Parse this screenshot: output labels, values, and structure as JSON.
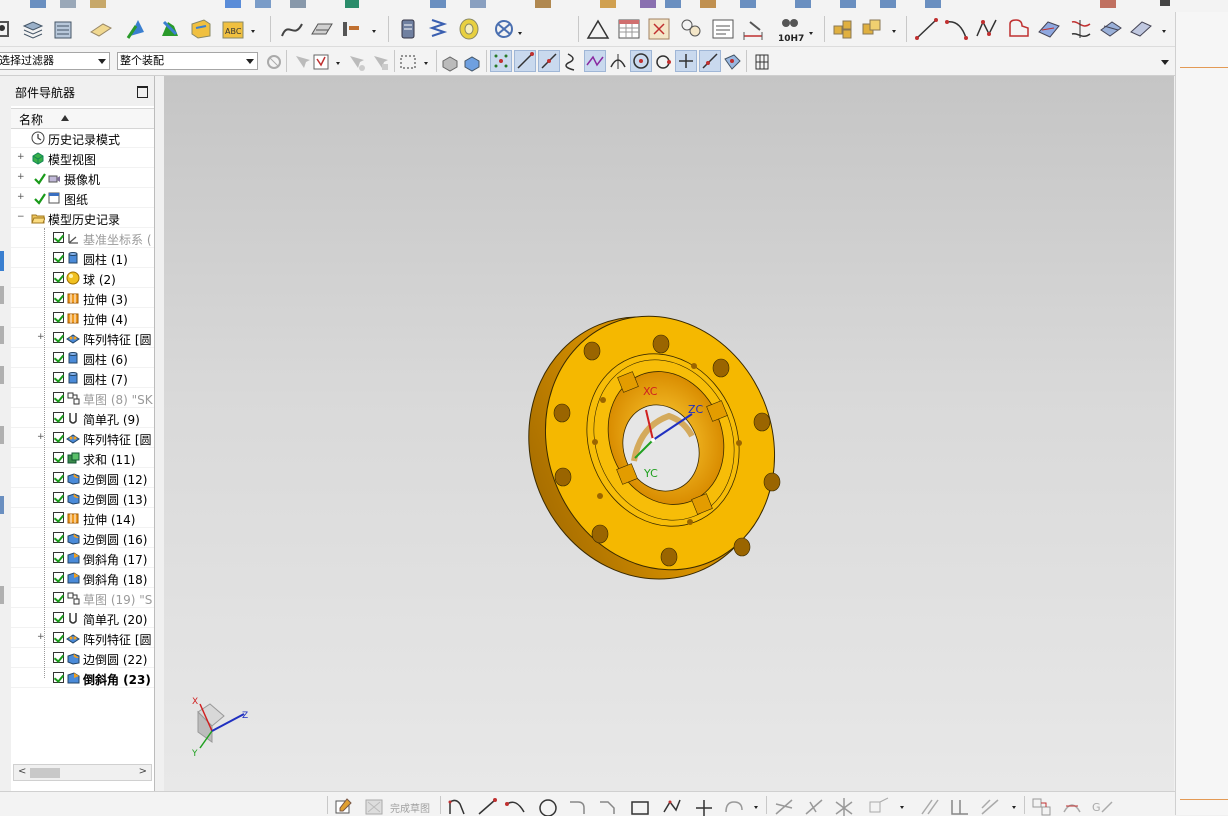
{
  "toolbar": {
    "selection_filter": "选择过滤器",
    "assembly_scope": "整个装配",
    "tolerance_label": "10H7"
  },
  "navigator": {
    "title": "部件导航器",
    "column_header": "名称",
    "items": [
      {
        "label": "历史记录模式",
        "icon": "clock-icon",
        "style": "normal"
      },
      {
        "label": "模型视图",
        "icon": "model-views-icon",
        "style": "normal"
      },
      {
        "label": "摄像机",
        "icon": "camera-icon",
        "style": "normal"
      },
      {
        "label": "图纸",
        "icon": "drawing-icon",
        "style": "normal"
      },
      {
        "label": "模型历史记录",
        "icon": "folder-open-icon",
        "style": "normal"
      },
      {
        "label": "基准坐标系 (",
        "icon": "datum-csys-icon",
        "style": "dim"
      },
      {
        "label": "圆柱 (1)",
        "icon": "cylinder-icon",
        "style": "normal"
      },
      {
        "label": "球 (2)",
        "icon": "sphere-icon",
        "style": "normal"
      },
      {
        "label": "拉伸 (3)",
        "icon": "extrude-icon",
        "style": "normal"
      },
      {
        "label": "拉伸 (4)",
        "icon": "extrude-icon",
        "style": "normal"
      },
      {
        "label": "阵列特征 [圆",
        "icon": "pattern-icon",
        "style": "normal"
      },
      {
        "label": "圆柱 (6)",
        "icon": "cylinder-icon",
        "style": "normal"
      },
      {
        "label": "圆柱 (7)",
        "icon": "cylinder-icon",
        "style": "normal"
      },
      {
        "label": "草图 (8) \"SK",
        "icon": "sketch-icon",
        "style": "dim"
      },
      {
        "label": "简单孔 (9)",
        "icon": "hole-icon",
        "style": "normal"
      },
      {
        "label": "阵列特征 [圆",
        "icon": "pattern-icon",
        "style": "normal"
      },
      {
        "label": "求和 (11)",
        "icon": "unite-icon",
        "style": "normal"
      },
      {
        "label": "边倒圆 (12)",
        "icon": "edge-blend-icon",
        "style": "normal"
      },
      {
        "label": "边倒圆 (13)",
        "icon": "edge-blend-icon",
        "style": "normal"
      },
      {
        "label": "拉伸 (14)",
        "icon": "extrude-icon",
        "style": "normal"
      },
      {
        "label": "边倒圆 (16)",
        "icon": "edge-blend-icon",
        "style": "normal"
      },
      {
        "label": "倒斜角 (17)",
        "icon": "chamfer-icon",
        "style": "normal"
      },
      {
        "label": "倒斜角 (18)",
        "icon": "chamfer-icon",
        "style": "normal"
      },
      {
        "label": "草图 (19) \"S",
        "icon": "sketch-icon",
        "style": "dim"
      },
      {
        "label": "简单孔 (20)",
        "icon": "hole-icon",
        "style": "normal"
      },
      {
        "label": "阵列特征 [圆",
        "icon": "pattern-icon",
        "style": "normal"
      },
      {
        "label": "边倒圆 (22)",
        "icon": "edge-blend-icon",
        "style": "normal"
      },
      {
        "label": "倒斜角 (23)",
        "icon": "chamfer-icon",
        "style": "bold"
      }
    ]
  },
  "csys": {
    "xc": "XC",
    "yc": "YC",
    "zc": "ZC",
    "tri_x": "X",
    "tri_y": "Y",
    "tri_z": "Z"
  },
  "bottom": {
    "finish_sketch": "完成草图"
  },
  "colors": {
    "part": "#f5b800",
    "part_dark": "#c98a00",
    "part_edge": "#3a2a00",
    "check_green": "#1a9a1a"
  }
}
